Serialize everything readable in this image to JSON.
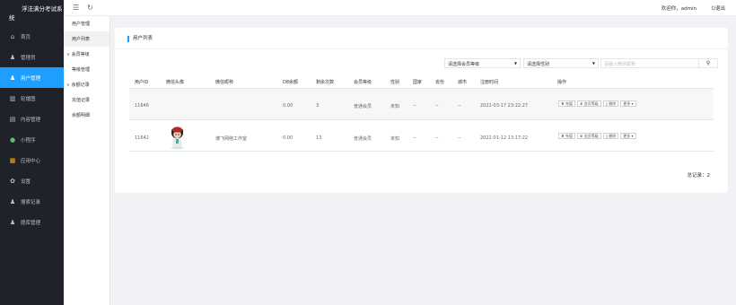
{
  "app": {
    "title": "浮法满分考试系统"
  },
  "sidebar": {
    "items": [
      {
        "label": "首页",
        "icon": "home-icon"
      },
      {
        "label": "管理员",
        "icon": "admin-user-icon"
      },
      {
        "label": "用户管理",
        "icon": "user-icon",
        "active": true
      },
      {
        "label": "轮播图",
        "icon": "carousel-icon"
      },
      {
        "label": "内容管理",
        "icon": "document-icon"
      },
      {
        "label": "小程序",
        "icon": "mini-program-icon"
      },
      {
        "label": "应用中心",
        "icon": "apps-grid-icon"
      },
      {
        "label": "设置",
        "icon": "gear-icon"
      },
      {
        "label": "搜索记录",
        "icon": "search-record-icon"
      },
      {
        "label": "题库管理",
        "icon": "question-bank-icon"
      }
    ]
  },
  "subnav": {
    "group1": "用户管理",
    "item1": "用户列表",
    "group2": "会员等级",
    "item2": "等级管理",
    "group3": "余额记录",
    "item3": "充值记录",
    "item4": "余额明细"
  },
  "header": {
    "welcome": "欢迎你，admin",
    "logout": "退出"
  },
  "content": {
    "title": "用户列表",
    "filters": {
      "level": "请选择会员等级",
      "gender": "请选择性别",
      "search_placeholder": "请输入微信昵称"
    },
    "columns": [
      "用户ID",
      "微信头像",
      "微信昵称",
      "D8余额",
      "剩余次数",
      "会员等级",
      "性别",
      "国家",
      "省份",
      "城市",
      "注册时间",
      "操作"
    ],
    "rows": [
      {
        "id": "11646",
        "nickname": "",
        "balance": "0.00",
        "remaining": "3",
        "level": "普通会员",
        "gender": "未知",
        "country": "--",
        "province": "--",
        "city": "--",
        "reg_time": "2022-03-17 23:22:27"
      },
      {
        "id": "11642",
        "nickname": "博飞网络工作室",
        "balance": "0.00",
        "remaining": "13",
        "level": "普通会员",
        "gender": "未知",
        "country": "--",
        "province": "--",
        "city": "--",
        "reg_time": "2022-01-12 13:17:22"
      }
    ],
    "actions": {
      "recharge": "充值",
      "member_level": "会员等级",
      "delete": "删除",
      "more": "更多"
    },
    "total": "总记录：2"
  },
  "colors": {
    "sidebar_bg": "#20222a",
    "accent": "#1e9fff",
    "page_bg": "#f0f2f5"
  }
}
